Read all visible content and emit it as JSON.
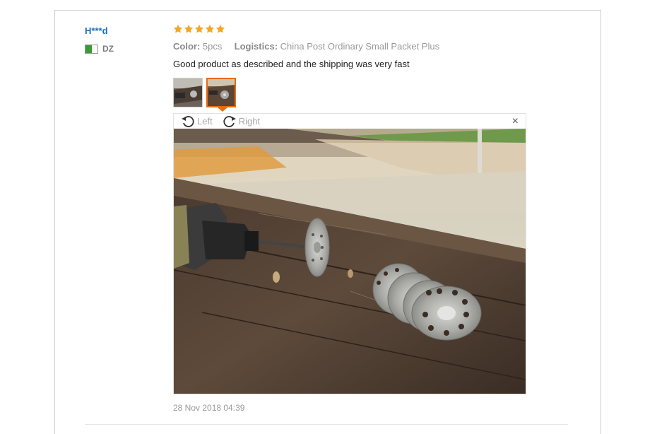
{
  "review": {
    "user_name": "H***d",
    "country": "DZ",
    "rating": 5,
    "attributes": [
      {
        "key": "Color:",
        "value": "5pcs"
      },
      {
        "key": "Logistics:",
        "value": "China Post Ordinary Small Packet Plus"
      }
    ],
    "text": "Good product as described and the shipping was very fast",
    "date": "28 Nov 2018 04:39"
  },
  "viewer": {
    "rotate_left_label": "Left",
    "rotate_right_label": "Right",
    "close_label": "×"
  },
  "colors": {
    "user_link": "#1a6fc1",
    "star": "#f5a623",
    "active_thumb": "#e86c0c"
  },
  "icons": [
    "star-icon",
    "flag-icon",
    "rotate-left-icon",
    "rotate-right-icon",
    "close-icon"
  ]
}
